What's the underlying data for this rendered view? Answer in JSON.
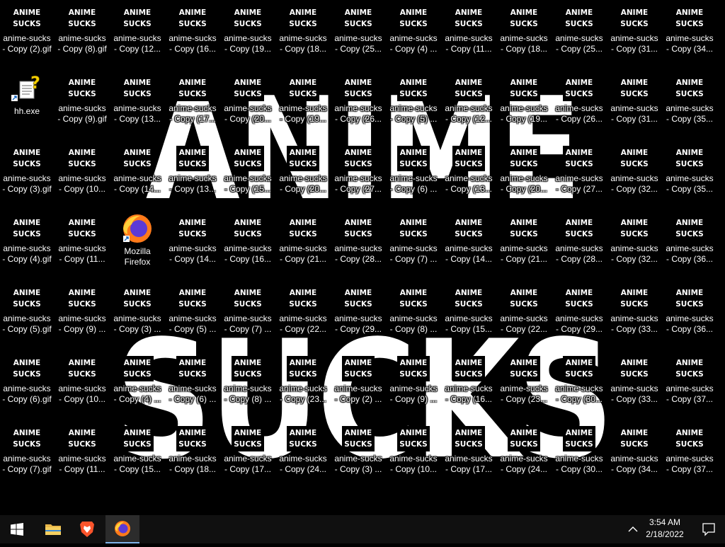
{
  "wallpaper": {
    "line1": "ANIME",
    "line2": "SUCKS"
  },
  "thumbnail": {
    "line1": "ANIME",
    "line2": "SUCKS"
  },
  "desktop_icons": [
    [
      "anime-sucks\n- Copy (2).gif",
      "hh.exe",
      "anime-sucks\n- Copy (3).gif",
      "anime-sucks\n- Copy (4).gif",
      "anime-sucks\n- Copy (5).gif",
      "anime-sucks\n- Copy (6).gif",
      "anime-sucks\n- Copy (7).gif"
    ],
    [
      "anime-sucks\n- Copy (8).gif",
      "anime-sucks\n- Copy (9).gif",
      "anime-sucks\n- Copy (10...",
      "anime-sucks\n- Copy (11...",
      "anime-sucks\n- Copy (9) ...",
      "anime-sucks\n- Copy (10...",
      "anime-sucks\n- Copy (11..."
    ],
    [
      "anime-sucks\n- Copy (12...",
      "anime-sucks\n- Copy (13...",
      "anime-sucks\n- Copy (14...",
      "Mozilla\nFirefox",
      "anime-sucks\n- Copy (3) ...",
      "anime-sucks\n- Copy (4) ...",
      "anime-sucks\n- Copy (15..."
    ],
    [
      "anime-sucks\n- Copy (16...",
      "anime-sucks\n- Copy (17...",
      "anime-sucks\n- Copy (13...",
      "anime-sucks\n- Copy (14...",
      "anime-sucks\n- Copy (5) ...",
      "anime-sucks\n- Copy (6) ...",
      "anime-sucks\n- Copy (18..."
    ],
    [
      "anime-sucks\n- Copy (19...",
      "anime-sucks\n- Copy (20...",
      "anime-sucks\n- Copy (15...",
      "anime-sucks\n- Copy (16...",
      "anime-sucks\n- Copy (7) ...",
      "anime-sucks\n- Copy (8) ...",
      "anime-sucks\n- Copy (17..."
    ],
    [
      "anime-sucks\n- Copy (18...",
      "anime-sucks\n- Copy (19...",
      "anime-sucks\n- Copy (20...",
      "anime-sucks\n- Copy (21...",
      "anime-sucks\n- Copy (22...",
      "anime-sucks\n- Copy (23...",
      "anime-sucks\n- Copy (24..."
    ],
    [
      "anime-sucks\n- Copy (25...",
      "anime-sucks\n- Copy (26...",
      "anime-sucks\n- Copy (27...",
      "anime-sucks\n- Copy (28...",
      "anime-sucks\n- Copy (29...",
      "anime-sucks\n- Copy (2) ...",
      "anime-sucks\n- Copy (3) ..."
    ],
    [
      "anime-sucks\n- Copy (4) ...",
      "anime-sucks\n- Copy (5) ...",
      "anime-sucks\n- Copy (6) ...",
      "anime-sucks\n- Copy (7) ...",
      "anime-sucks\n- Copy (8) ...",
      "anime-sucks\n- Copy (9) ...",
      "anime-sucks\n- Copy (10..."
    ],
    [
      "anime-sucks\n- Copy (11...",
      "anime-sucks\n- Copy (12...",
      "anime-sucks\n- Copy (13...",
      "anime-sucks\n- Copy (14...",
      "anime-sucks\n- Copy (15...",
      "anime-sucks\n- Copy (16...",
      "anime-sucks\n- Copy (17..."
    ],
    [
      "anime-sucks\n- Copy (18...",
      "anime-sucks\n- Copy (19...",
      "anime-sucks\n- Copy (20...",
      "anime-sucks\n- Copy (21...",
      "anime-sucks\n- Copy (22...",
      "anime-sucks\n- Copy (23...",
      "anime-sucks\n- Copy (24..."
    ],
    [
      "anime-sucks\n- Copy (25...",
      "anime-sucks\n- Copy (26...",
      "anime-sucks\n- Copy (27...",
      "anime-sucks\n- Copy (28...",
      "anime-sucks\n- Copy (29...",
      "anime-sucks\n- Copy (30...",
      "anime-sucks\n- Copy (30..."
    ],
    [
      "anime-sucks\n- Copy (31...",
      "anime-sucks\n- Copy (31...",
      "anime-sucks\n- Copy (32...",
      "anime-sucks\n- Copy (32...",
      "anime-sucks\n- Copy (33...",
      "anime-sucks\n- Copy (33...",
      "anime-sucks\n- Copy (34..."
    ],
    [
      "anime-sucks\n- Copy (34...",
      "anime-sucks\n- Copy (35...",
      "anime-sucks\n- Copy (35...",
      "anime-sucks\n- Copy (36...",
      "anime-sucks\n- Copy (36...",
      "anime-sucks\n- Copy (37...",
      "anime-sucks\n- Copy (37..."
    ]
  ],
  "taskbar": {
    "start_icon": "windows-logo-icon",
    "pinned": [
      {
        "name": "file-explorer",
        "icon": "folder-icon"
      },
      {
        "name": "brave-browser",
        "icon": "brave-lion-icon"
      },
      {
        "name": "firefox",
        "icon": "firefox-icon",
        "active": true
      }
    ],
    "tray_icon": "chevron-up-icon",
    "time": "3:54 AM",
    "date": "2/18/2022",
    "notification_icon": "notification-icon"
  },
  "colors": {
    "taskbar": "#101010",
    "accent": "#7eb4ea",
    "desktop": "#000000"
  }
}
